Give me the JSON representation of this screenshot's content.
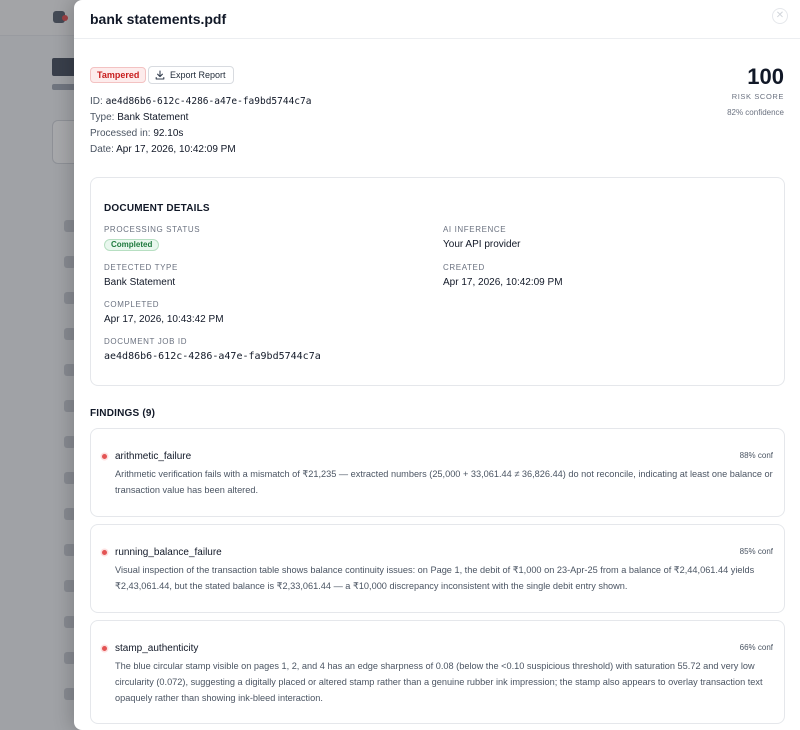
{
  "panel": {
    "title": "bank statements.pdf",
    "close_icon": "close-icon"
  },
  "status_badge": "Tampered",
  "export_button": "Export Report",
  "meta": {
    "id_label": "ID:",
    "id_value": "ae4d86b6-612c-4286-a47e-fa9bd5744c7a",
    "type_label": "Type:",
    "type_value": "Bank Statement",
    "processed_label": "Processed in:",
    "processed_value": "92.10s",
    "date_label": "Date:",
    "date_value": "Apr 17, 2026, 10:42:09 PM"
  },
  "risk": {
    "score": "100",
    "label": "RISK SCORE",
    "confidence": "82% confidence"
  },
  "details": {
    "title": "DOCUMENT DETAILS",
    "processing_status_label": "PROCESSING STATUS",
    "processing_status_value": "Completed",
    "ai_inference_label": "AI INFERENCE",
    "ai_inference_value": "Your API provider",
    "detected_type_label": "DETECTED TYPE",
    "detected_type_value": "Bank Statement",
    "created_label": "CREATED",
    "created_value": "Apr 17, 2026, 10:42:09 PM",
    "completed_label": "COMPLETED",
    "completed_value": "Apr 17, 2026, 10:43:42 PM",
    "job_id_label": "DOCUMENT JOB ID",
    "job_id_value": "ae4d86b6-612c-4286-a47e-fa9bd5744c7a"
  },
  "findings": {
    "title": "FINDINGS (9)",
    "items": [
      {
        "name": "arithmetic_failure",
        "confidence": "88% conf",
        "description": "Arithmetic verification fails with a mismatch of ₹21,235 — extracted numbers (25,000 + 33,061.44 ≠ 36,826.44) do not reconcile, indicating at least one balance or transaction value has been altered."
      },
      {
        "name": "running_balance_failure",
        "confidence": "85% conf",
        "description": "Visual inspection of the transaction table shows balance continuity issues: on Page 1, the debit of ₹1,000 on 23-Apr-25 from a balance of ₹2,44,061.44 yields ₹2,43,061.44, but the stated balance is ₹2,33,061.44 — a ₹10,000 discrepancy inconsistent with the single debit entry shown."
      },
      {
        "name": "stamp_authenticity",
        "confidence": "66% conf",
        "description": "The blue circular stamp visible on pages 1, 2, and 4 has an edge sharpness of 0.08 (below the <0.10 suspicious threshold) with saturation 55.72 and very low circularity (0.072), suggesting a digitally placed or altered stamp rather than a genuine rubber ink impression; the stamp also appears to overlay transaction text opaquely rather than showing ink-bleed interaction."
      }
    ]
  },
  "colors": {
    "danger": "#c81e1e",
    "success": "#1f7a3e",
    "finding_dot": "#e35454"
  }
}
